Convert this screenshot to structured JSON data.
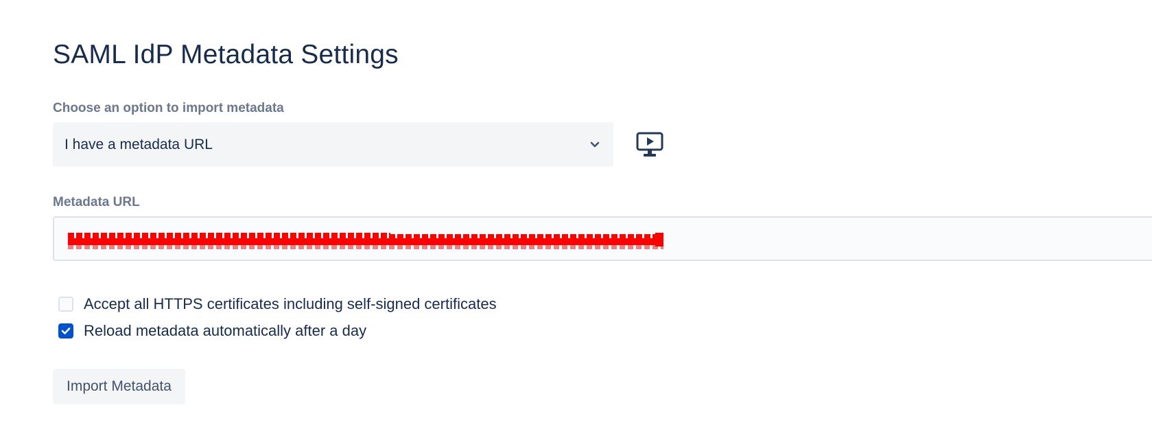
{
  "page": {
    "title": "SAML IdP Metadata Settings"
  },
  "import_option": {
    "label": "Choose an option to import metadata",
    "selected": "I have a metadata URL",
    "icon": "chevron-down-icon"
  },
  "video_button": {
    "icon": "video-tutorial-icon"
  },
  "metadata_url": {
    "label": "Metadata URL"
  },
  "options": {
    "accept_https": {
      "label": "Accept all HTTPS certificates including self-signed certificates",
      "checked": false
    },
    "reload_metadata": {
      "label": "Reload metadata automatically after a day",
      "checked": true
    }
  },
  "actions": {
    "import_label": "Import Metadata"
  },
  "colors": {
    "primary": "#0052cc",
    "text": "#172b4d",
    "label": "#6b778c",
    "field_bg": "#f4f5f7",
    "redaction": "#ff0000"
  }
}
